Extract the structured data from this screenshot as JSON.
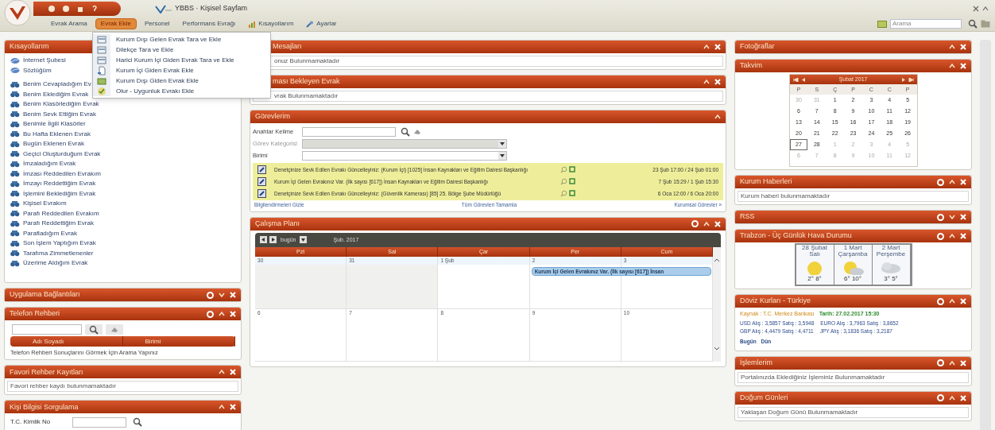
{
  "title_bar": {
    "title": "YBBS · Kişisel Sayfam"
  },
  "menu": [
    {
      "label": "Evrak Arama",
      "selected": false
    },
    {
      "label": "Evrak Ekle",
      "selected": true
    },
    {
      "label": "Personel",
      "selected": false
    },
    {
      "label": "Performans Evrağı",
      "selected": false
    },
    {
      "label": "Kısayollarım",
      "selected": false
    },
    {
      "label": "Ayarlar",
      "selected": false
    }
  ],
  "search": {
    "placeholder": "Arama"
  },
  "dropdown": [
    "Kurum Dışı Gelen Evrak Tara ve Ekle",
    "Dilekçe Tara ve Ekle",
    "Harici Kurum İçi Giden Evrak Tara ve Ekle",
    "Kurum İçi Giden Evrak Ekle",
    "Kurum Dışı Giden Evrak Ekle",
    "Olur - Uygunluk Evrakı Ekle"
  ],
  "left": [
    {
      "kind": "links",
      "title": "Kısayollarım",
      "items": [
        {
          "label": "İnternet Şubesi",
          "kind": "web"
        },
        {
          "label": "Sözlüğüm",
          "kind": "web"
        },
        {
          "label": "Benim Cevapladığım Ev",
          "kind": "search"
        },
        {
          "label": "Benim Eklediğim Evrak",
          "kind": "search"
        },
        {
          "label": "Benim Klasörlediğim Evrak",
          "kind": "search"
        },
        {
          "label": "Benim Sevk Ettiğim Evrak",
          "kind": "search"
        },
        {
          "label": "Benimle İlgili Klasörler",
          "kind": "search"
        },
        {
          "label": "Bu Hafta Eklenen Evrak",
          "kind": "search"
        },
        {
          "label": "Bugün Eklenen Evrak",
          "kind": "search"
        },
        {
          "label": "Geçici Oluşturduğum Evrak",
          "kind": "search"
        },
        {
          "label": "İmzaladığım Evrak",
          "kind": "search"
        },
        {
          "label": "İmzası Reddedilen Evrakım",
          "kind": "search"
        },
        {
          "label": "İmzayı Reddettiğim Evrak",
          "kind": "search"
        },
        {
          "label": "İşlemini Beklediğim Evrak",
          "kind": "search"
        },
        {
          "label": "Kişisel Evrakım",
          "kind": "search"
        },
        {
          "label": "Parafı Reddedilen Evrakım",
          "kind": "search"
        },
        {
          "label": "Parafı Reddettiğim Evrak",
          "kind": "search"
        },
        {
          "label": "Parafladığım Evrak",
          "kind": "search"
        },
        {
          "label": "Son İşlem Yaptığım Evrak",
          "kind": "search"
        },
        {
          "label": "Tarafıma Zimmetlenenler",
          "kind": "search"
        },
        {
          "label": "Üzerime Aldığım Evrak",
          "kind": "search"
        }
      ]
    },
    {
      "kind": "none",
      "title": "Uygulama Bağlantıları",
      "settings": true,
      "expanded": false,
      "closable": true
    },
    {
      "kind": "phone",
      "title": "Telefon Rehberi",
      "settings": true,
      "expanded": true,
      "closable": true,
      "columns": [
        "Adı Soyadı",
        "Birimi"
      ],
      "note": "Telefon Rehberi Sonuçlarını Görmek İçin Arama Yapınız"
    },
    {
      "kind": "message",
      "title": "Favori Rehber Kayıtları",
      "settings": false,
      "expanded": true,
      "closable": true,
      "text": "Favori rehber kaydı bulunmamaktadır"
    },
    {
      "kind": "query",
      "title": "Kişi Bilgisi Sorgulama",
      "settings": false,
      "expanded": true,
      "closable": true,
      "label": "T.C. Kimlik No"
    }
  ],
  "middle": [
    {
      "kind": "message",
      "title": "Mesajları",
      "settings": false,
      "expanded": true,
      "closable": true,
      "text": "onuz Bulunmamaktadır"
    },
    {
      "kind": "message",
      "title": "ması Bekleyen Evrak",
      "settings": false,
      "expanded": true,
      "closable": true,
      "text": "vrak Bulunmamaktadır"
    },
    {
      "kind": "tasks",
      "title": "Görevlerim",
      "settings": false,
      "expanded": true,
      "closable": false,
      "fields": [
        {
          "label": "Anahtar Kelime",
          "kind": "search"
        },
        {
          "label": "Görev Kategorisi",
          "kind": "select",
          "disabled": true
        },
        {
          "label": "Birimi",
          "kind": "select",
          "disabled": false
        }
      ],
      "rows": [
        {
          "text": "Denetçinize Sevk Edilen Evrakı Güncelleyiniz: (Kurum İçi) [1025] İnsan Kaynakları ve Eğitim Dairesi Başkanlığı",
          "dates": "23 Şub 17:00 / 24 Şub 01:00"
        },
        {
          "text": "Kurum İçi Gelen Evrakınız Var. (İlk sayısı [617]) İnsan Kaynakları ve Eğitim Dairesi Başkanlığı",
          "dates": "7 Şub 15:29 / 1 Şub 15:30"
        },
        {
          "text": "Denetçinize Sevk Edilen Evrakı Güncelleyiniz: (Güvenlik Kamerası) [85] 25. Bölge Şube Müdürlüğü",
          "dates": "6 Oca 12:00 / 6 Oca 20:00"
        }
      ],
      "links": [
        "Bilgilendirmeleri Gizle",
        "Tüm Görevleri Tamamla",
        "Kurumsal Görevler »"
      ]
    },
    {
      "kind": "planner",
      "title": "Çalışma Planı",
      "settings": true,
      "expanded": true,
      "closable": true,
      "today": "bugün",
      "month": "Şub. 2017",
      "columns": [
        "Pzt",
        "Sal",
        "Çar",
        "Per",
        "Cum"
      ],
      "weeks": [
        [
          {
            "label": "30",
            "past": true
          },
          {
            "label": "31",
            "past": true
          },
          {
            "label": "1 Şub",
            "past": false
          },
          {
            "label": "2",
            "past": false,
            "event": "Kurum İçi Gelen Evrakınız Var. (İlk sayısı [617]) İnsan"
          },
          {
            "label": "3",
            "past": false
          }
        ],
        [
          {
            "label": "6",
            "past": false
          },
          {
            "label": "7",
            "past": false
          },
          {
            "label": "8",
            "past": false
          },
          {
            "label": "9",
            "past": false
          },
          {
            "label": "10",
            "past": false
          }
        ]
      ]
    }
  ],
  "right": [
    {
      "kind": "none",
      "title": "Fotoğraflar",
      "settings": false,
      "expanded": true,
      "closable": true
    },
    {
      "kind": "calendar",
      "title": "Takvim",
      "settings": false,
      "expanded": true,
      "closable": true,
      "month": "Şubat 2017",
      "weekdays": [
        "P",
        "S",
        "Ç",
        "P",
        "C",
        "C",
        "P"
      ],
      "weeks": [
        [
          {
            "d": "30",
            "other": true,
            "selected": false
          },
          {
            "d": "31",
            "other": true,
            "selected": false
          },
          {
            "d": "1",
            "other": false,
            "selected": false
          },
          {
            "d": "2",
            "other": false,
            "selected": false
          },
          {
            "d": "3",
            "other": false,
            "selected": false
          },
          {
            "d": "4",
            "other": false,
            "selected": false
          },
          {
            "d": "5",
            "other": false,
            "selected": false
          }
        ],
        [
          {
            "d": "6",
            "other": false,
            "selected": false
          },
          {
            "d": "7",
            "other": false,
            "selected": false
          },
          {
            "d": "8",
            "other": false,
            "selected": false
          },
          {
            "d": "9",
            "other": false,
            "selected": false
          },
          {
            "d": "10",
            "other": false,
            "selected": false
          },
          {
            "d": "11",
            "other": false,
            "selected": false
          },
          {
            "d": "12",
            "other": false,
            "selected": false
          }
        ],
        [
          {
            "d": "13",
            "other": false,
            "selected": false
          },
          {
            "d": "14",
            "other": false,
            "selected": false
          },
          {
            "d": "15",
            "other": false,
            "selected": false
          },
          {
            "d": "16",
            "other": false,
            "selected": false
          },
          {
            "d": "17",
            "other": false,
            "selected": false
          },
          {
            "d": "18",
            "other": false,
            "selected": false
          },
          {
            "d": "19",
            "other": false,
            "selected": false
          }
        ],
        [
          {
            "d": "20",
            "other": false,
            "selected": false
          },
          {
            "d": "21",
            "other": false,
            "selected": false
          },
          {
            "d": "22",
            "other": false,
            "selected": false
          },
          {
            "d": "23",
            "other": false,
            "selected": false
          },
          {
            "d": "24",
            "other": false,
            "selected": false
          },
          {
            "d": "25",
            "other": false,
            "selected": false
          },
          {
            "d": "26",
            "other": false,
            "selected": false
          }
        ],
        [
          {
            "d": "27",
            "other": false,
            "selected": true
          },
          {
            "d": "28",
            "other": false,
            "selected": false
          },
          {
            "d": "1",
            "other": true,
            "selected": false
          },
          {
            "d": "2",
            "other": true,
            "selected": false
          },
          {
            "d": "3",
            "other": true,
            "selected": false
          },
          {
            "d": "4",
            "other": true,
            "selected": false
          },
          {
            "d": "5",
            "other": true,
            "selected": false
          }
        ],
        [
          {
            "d": "6",
            "other": true,
            "selected": false
          },
          {
            "d": "7",
            "other": true,
            "selected": false
          },
          {
            "d": "8",
            "other": true,
            "selected": false
          },
          {
            "d": "9",
            "other": true,
            "selected": false
          },
          {
            "d": "10",
            "other": true,
            "selected": false
          },
          {
            "d": "11",
            "other": true,
            "selected": false
          },
          {
            "d": "12",
            "other": true,
            "selected": false
          }
        ]
      ]
    },
    {
      "kind": "message",
      "title": "Kurum Haberleri",
      "settings": true,
      "expanded": true,
      "closable": true,
      "text": "Kurum haberi bulunmamaktadır"
    },
    {
      "kind": "none",
      "title": "RSS",
      "settings": true,
      "expanded": false,
      "closable": true
    },
    {
      "kind": "weather",
      "title": "Trabzon - Üç Günlük Hava Durumu",
      "settings": true,
      "expanded": true,
      "closable": true,
      "days": [
        {
          "date": "28 Şubat",
          "weekday": "Salı",
          "temps": "2° 8°"
        },
        {
          "date": "1 Mart",
          "weekday": "Çarşamba",
          "temps": "6° 10°"
        },
        {
          "date": "2 Mart",
          "weekday": "Perşembe",
          "temps": "3° 5°"
        }
      ]
    },
    {
      "kind": "currency",
      "title": "Döviz Kurları - Türkiye",
      "settings": true,
      "expanded": true,
      "closable": true,
      "source": "Kaynak : T.C. Merkez Bankası",
      "date": "Tarih: 27.02.2017 15:30",
      "rates": [
        [
          "USD Alış : 3,5857 Satış : 3,5948",
          "EURO Alış : 3,7963 Satış : 3,8652"
        ],
        [
          "GBP Alış : 4,4479 Satış : 4,4711",
          "JPY Alış : 3,1836 Satış : 3,2187"
        ]
      ],
      "links": [
        "Bugün",
        "Dün"
      ]
    },
    {
      "kind": "message",
      "title": "İşlemlerim",
      "settings": true,
      "expanded": true,
      "closable": true,
      "text": "Portalınızda Eklediğiniz İşleminiz Bulunmamaktadır"
    },
    {
      "kind": "message",
      "title": "Doğum Günleri",
      "settings": true,
      "expanded": true,
      "closable": true,
      "text": "Yaklaşan Doğum Günü Bulunmamaktadır"
    }
  ]
}
